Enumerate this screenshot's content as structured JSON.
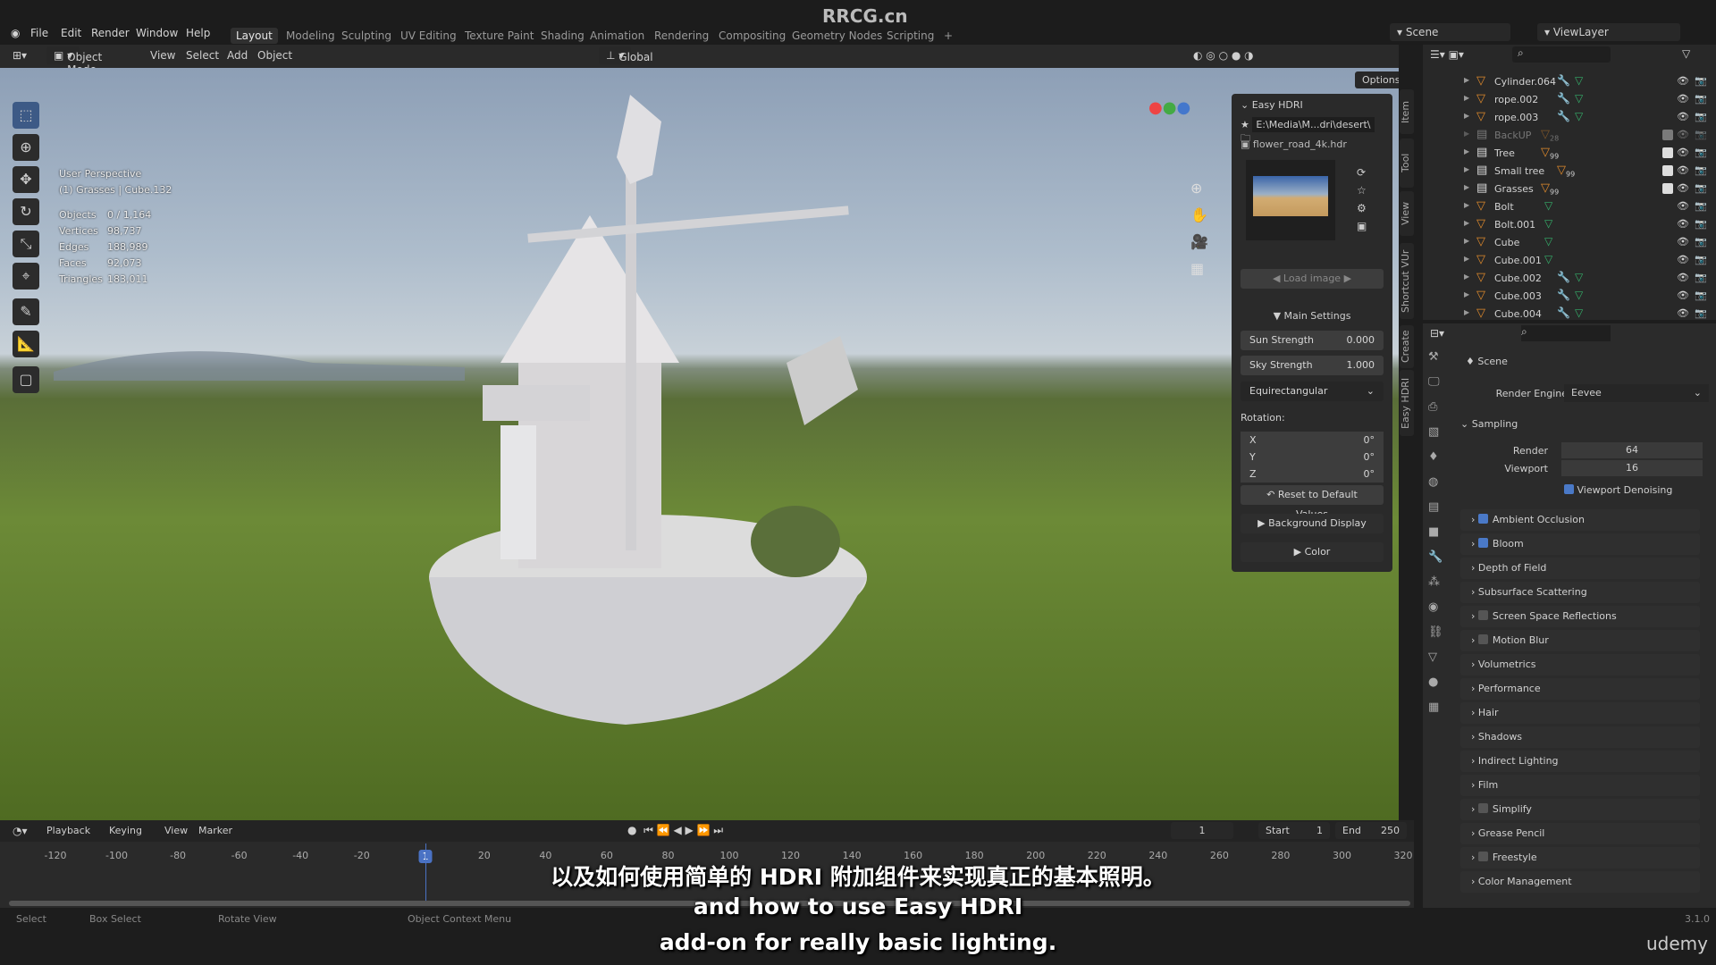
{
  "brand": "RRCG.cn",
  "menu": [
    "File",
    "Edit",
    "Render",
    "Window",
    "Help"
  ],
  "workspaces": [
    "Layout",
    "Modeling",
    "Sculpting",
    "UV Editing",
    "Texture Paint",
    "Shading",
    "Animation",
    "Rendering",
    "Compositing",
    "Geometry Nodes",
    "Scripting",
    "+"
  ],
  "active_workspace": "Layout",
  "scene": "Scene",
  "view_layer": "ViewLayer",
  "header": {
    "mode": "Object Mode",
    "items": [
      "View",
      "Select",
      "Add",
      "Object"
    ],
    "orientation": "Global",
    "options": "Options"
  },
  "viewport": {
    "perspective": "User Perspective",
    "collection": "(1) Grasses | Cube.132",
    "stats": [
      {
        "k": "Objects",
        "v": "0 / 1,164"
      },
      {
        "k": "Vertices",
        "v": "98,737"
      },
      {
        "k": "Edges",
        "v": "188,989"
      },
      {
        "k": "Faces",
        "v": "92,073"
      },
      {
        "k": "Triangles",
        "v": "183,011"
      }
    ]
  },
  "easy_hdri": {
    "title": "Easy HDRI",
    "path": "E:\\Media\\M...dri\\desert\\",
    "file": "flower_road_4k.hdr",
    "load_image": "Load image",
    "main_settings": "Main Settings",
    "sun_label": "Sun Strength",
    "sun_value": "0.000",
    "sky_label": "Sky Strength",
    "sky_value": "1.000",
    "projection": "Equirectangular",
    "rotation": "Rotation:",
    "rot": [
      {
        "k": "X",
        "v": "0°"
      },
      {
        "k": "Y",
        "v": "0°"
      },
      {
        "k": "Z",
        "v": "0°"
      }
    ],
    "reset": "Reset to Default Values",
    "background_display": "Background Display",
    "color": "Color"
  },
  "side_tabs": [
    "Item",
    "Tool",
    "View",
    "Shortcut VUr",
    "Create",
    "Easy HDRI"
  ],
  "outliner": [
    {
      "name": "Cylinder.064",
      "type": "mesh",
      "mod": true
    },
    {
      "name": "rope.002",
      "type": "mesh",
      "mod": true
    },
    {
      "name": "rope.003",
      "type": "mesh",
      "mod": true
    },
    {
      "name": "BackUP",
      "type": "collection",
      "badge": "28"
    },
    {
      "name": "Tree",
      "type": "collection",
      "badge": "99"
    },
    {
      "name": "Small tree",
      "type": "collection",
      "badge": "99"
    },
    {
      "name": "Grasses",
      "type": "collection",
      "badge": "99"
    },
    {
      "name": "Bolt",
      "type": "mesh"
    },
    {
      "name": "Bolt.001",
      "type": "mesh"
    },
    {
      "name": "Cube",
      "type": "mesh"
    },
    {
      "name": "Cube.001",
      "type": "mesh"
    },
    {
      "name": "Cube.002",
      "type": "mesh",
      "mod": true
    },
    {
      "name": "Cube.003",
      "type": "mesh",
      "mod": true
    },
    {
      "name": "Cube.004",
      "type": "mesh",
      "mod": true
    }
  ],
  "properties": {
    "context": "Scene",
    "render_engine_label": "Render Engine",
    "render_engine": "Eevee",
    "sampling": "Sampling",
    "render_label": "Render",
    "render_value": "64",
    "viewport_label": "Viewport",
    "viewport_value": "16",
    "denoise": "Viewport Denoising",
    "sections": [
      {
        "label": "Ambient Occlusion",
        "cb": "on"
      },
      {
        "label": "Bloom",
        "cb": "on"
      },
      {
        "label": "Depth of Field"
      },
      {
        "label": "Subsurface Scattering"
      },
      {
        "label": "Screen Space Reflections",
        "cb": "off"
      },
      {
        "label": "Motion Blur",
        "cb": "off"
      },
      {
        "label": "Volumetrics"
      },
      {
        "label": "Performance"
      },
      {
        "label": "Hair"
      },
      {
        "label": "Shadows"
      },
      {
        "label": "Indirect Lighting"
      },
      {
        "label": "Film"
      },
      {
        "label": "Simplify",
        "cb": "off"
      },
      {
        "label": "Grease Pencil"
      },
      {
        "label": "Freestyle",
        "cb": "off"
      },
      {
        "label": "Color Management"
      }
    ]
  },
  "timeline": {
    "menus": [
      "Playback",
      "Keying",
      "View",
      "Marker"
    ],
    "current": "1",
    "start_label": "Start",
    "start": "1",
    "end_label": "End",
    "end": "250",
    "ticks": [
      "-120",
      "-100",
      "-80",
      "-60",
      "-40",
      "-20",
      "1",
      "20",
      "40",
      "60",
      "80",
      "100",
      "120",
      "140",
      "160",
      "180",
      "200",
      "220",
      "240",
      "260",
      "280",
      "300",
      "320"
    ]
  },
  "status": {
    "select": "Select",
    "box_select": "Box Select",
    "rotate": "Rotate View",
    "context_menu": "Object Context Menu",
    "version": "3.1.0"
  },
  "subtitles": [
    "以及如何使用简单的 HDRI 附加组件来实现真正的基本照明。",
    "and how to use Easy HDRI",
    "add-on for really basic lighting."
  ],
  "watermark": "udemy"
}
